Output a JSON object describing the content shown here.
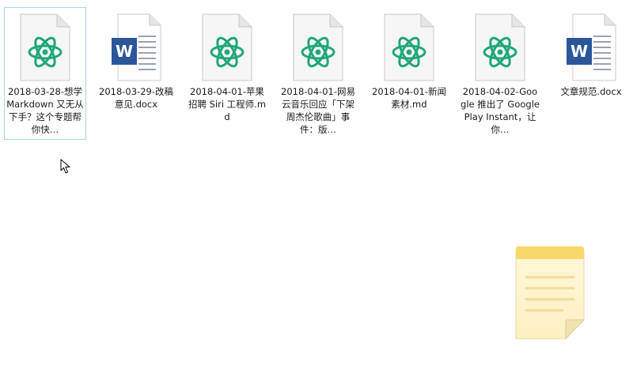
{
  "files": [
    {
      "type": "md",
      "icon": "atom-icon",
      "name": "2018-03-28-想学 Markdown 又无从下手？这个专题帮你快…",
      "selected": true
    },
    {
      "type": "docx",
      "icon": "word-document-icon",
      "name": "2018-03-29-改稿意见.docx",
      "selected": false
    },
    {
      "type": "md",
      "icon": "atom-icon",
      "name": "2018-04-01-苹果招聘 Siri 工程师.md",
      "selected": false
    },
    {
      "type": "md",
      "icon": "atom-icon",
      "name": "2018-04-01-网易云音乐回应「下架周杰伦歌曲」事件：版…",
      "selected": false
    },
    {
      "type": "md",
      "icon": "atom-icon",
      "name": "2018-04-01-新闻素材.md",
      "selected": false
    },
    {
      "type": "md",
      "icon": "atom-icon",
      "name": "2018-04-02-Google 推出了 Google Play Instant，让你…",
      "selected": false
    },
    {
      "type": "docx",
      "icon": "word-document-icon",
      "name": "文章规范.docx",
      "selected": false
    }
  ],
  "colors": {
    "atom_green": "#1fa67a",
    "word_blue": "#2b579a",
    "selection_border": "#a8d2ee",
    "note_yellow_top": "#f9d86b",
    "note_body": "#fdf5d4"
  }
}
